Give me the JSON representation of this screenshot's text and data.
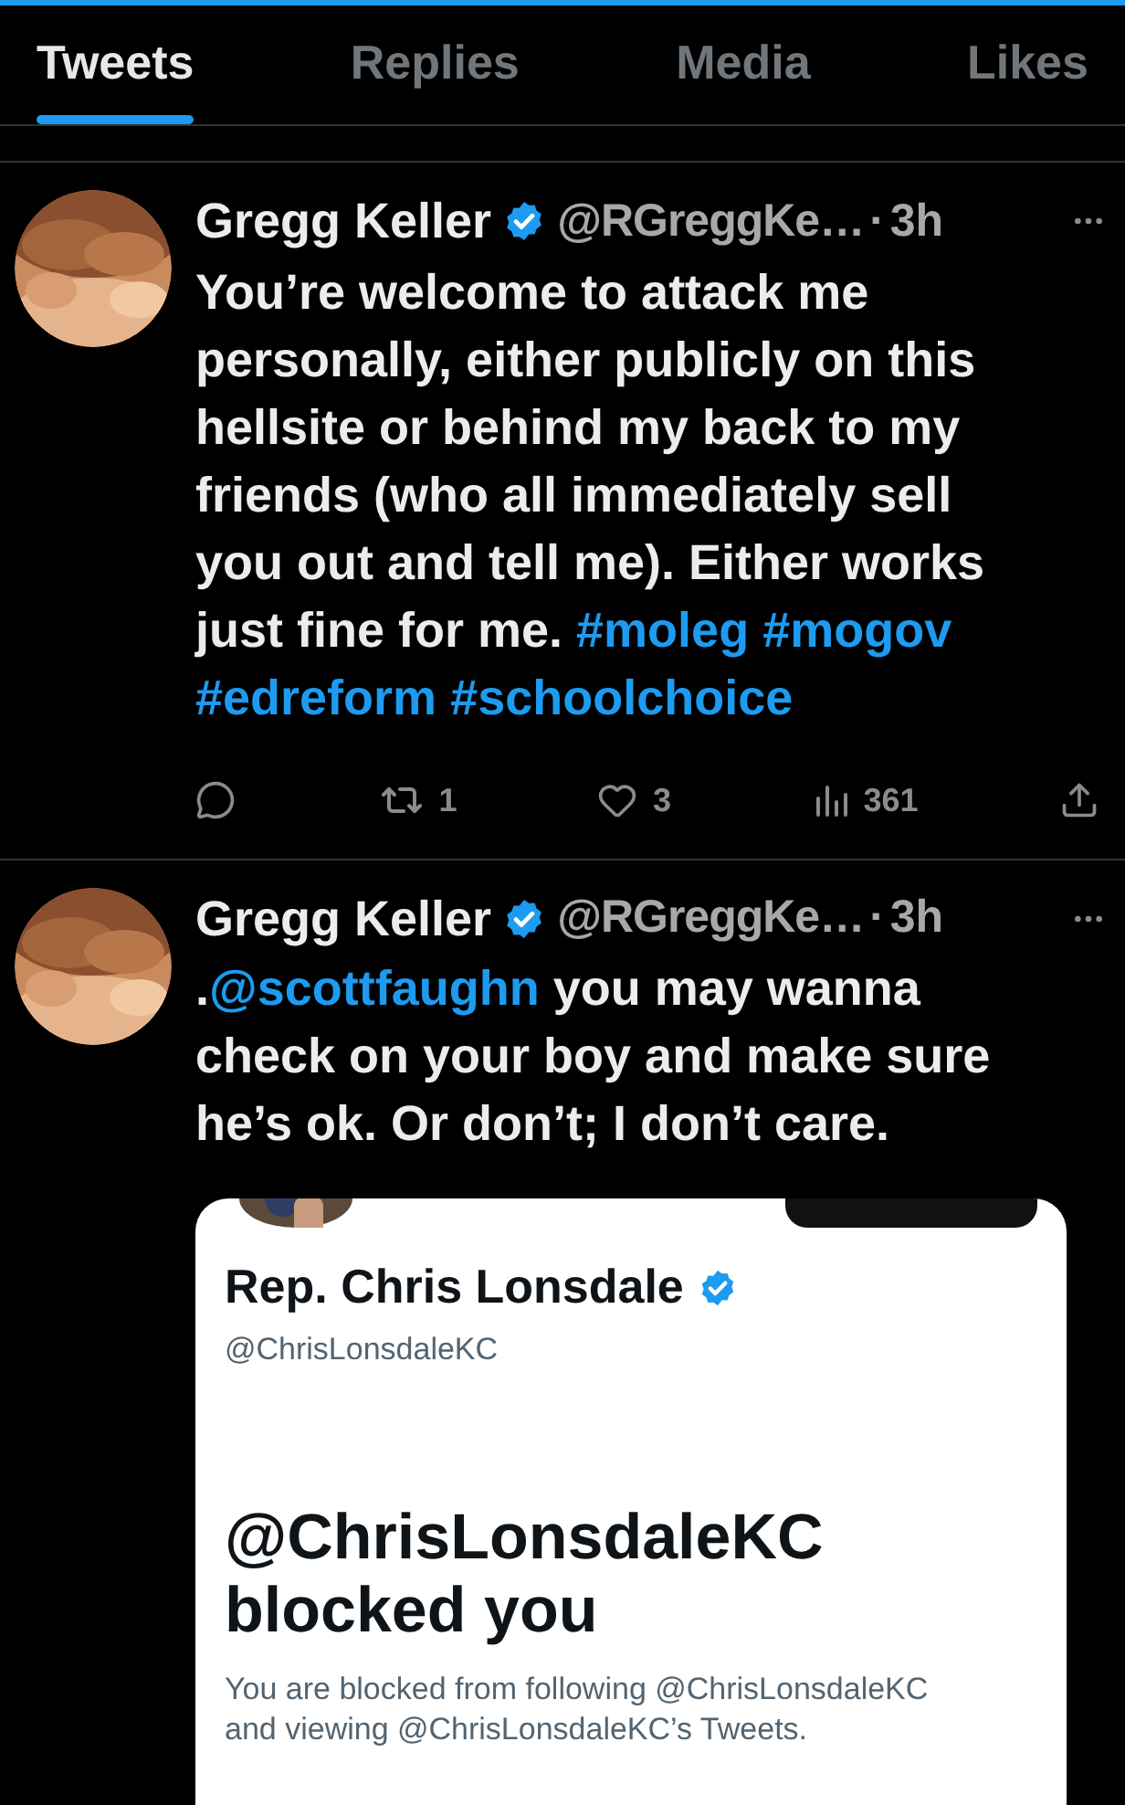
{
  "tabs": [
    {
      "label": "Tweets",
      "selected": true
    },
    {
      "label": "Replies",
      "selected": false
    },
    {
      "label": "Media",
      "selected": false
    },
    {
      "label": "Likes",
      "selected": false
    }
  ],
  "tweets": [
    {
      "author": "Gregg Keller",
      "verified": true,
      "handle": "@RGreggKe…",
      "separator": "·",
      "time": "3h",
      "body": [
        {
          "kind": "text",
          "text": "You’re welcome to attack me personally, either publicly on this hellsite or behind my back to my friends (who all immediately sell you out and tell me). Either works just fine for me. "
        },
        {
          "kind": "hashtag",
          "text": "#moleg"
        },
        {
          "kind": "hashtag",
          "text": "#mogov"
        },
        {
          "kind": "hashtag",
          "text": "#edreform"
        },
        {
          "kind": "hashtag",
          "text": "#schoolchoice"
        }
      ],
      "actions": [
        {
          "kind": "reply"
        },
        {
          "kind": "retweet",
          "count": "1"
        },
        {
          "kind": "like",
          "count": "3"
        },
        {
          "kind": "views",
          "count": "361"
        },
        {
          "kind": "share"
        }
      ]
    },
    {
      "author": "Gregg Keller",
      "verified": true,
      "handle": "@RGreggKe…",
      "separator": "·",
      "time": "3h",
      "body": [
        {
          "kind": "text",
          "text": "."
        },
        {
          "kind": "mention",
          "text": "@scottfaughn"
        },
        {
          "kind": "text",
          "text": " you may wanna check on your boy and make sure he’s ok. Or don’t; I don’t care."
        }
      ],
      "embed": {
        "name": "Rep. Chris Lonsdale",
        "verified": true,
        "handle": "@ChrisLonsdaleKC",
        "headline_handle": "@ChrisLonsdaleKC",
        "headline": "blocked you",
        "message": "You are blocked from following @ChrisLonsdaleKC and viewing @ChrisLonsdaleKC’s Tweets."
      }
    }
  ]
}
